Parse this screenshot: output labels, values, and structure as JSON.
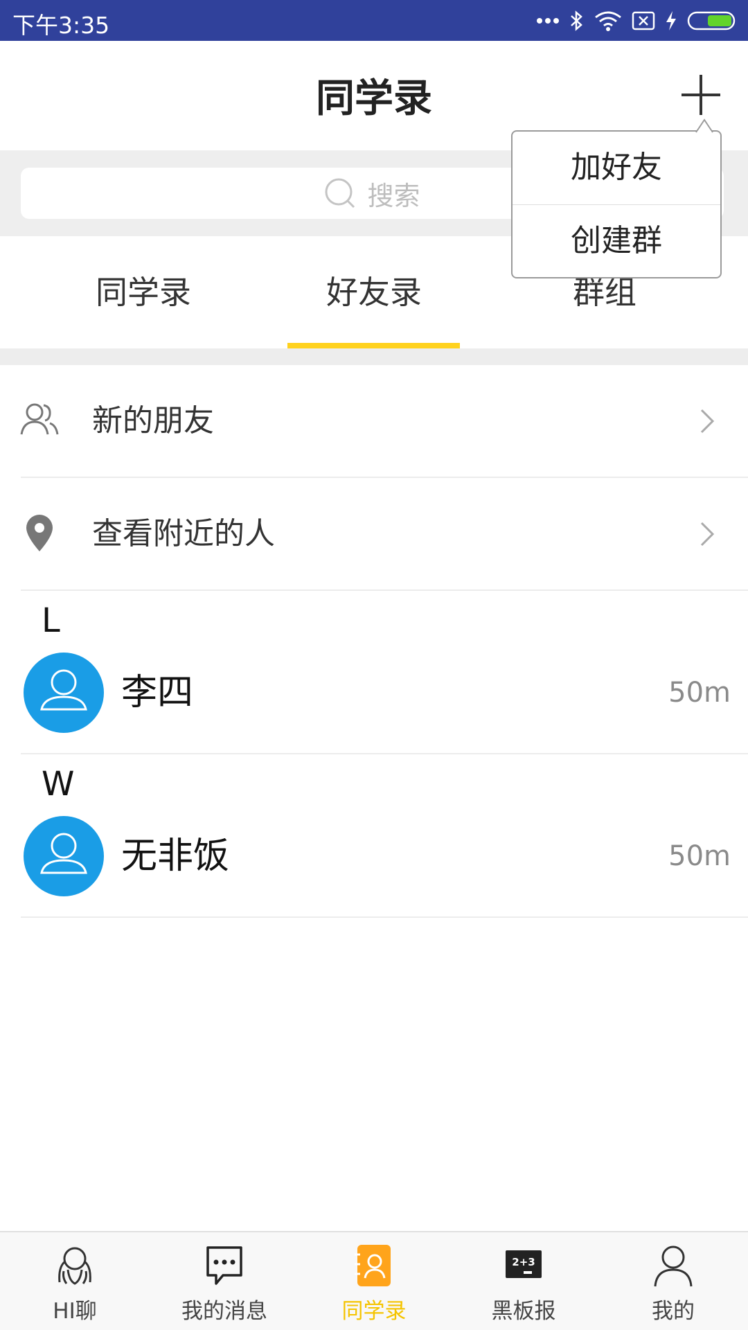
{
  "status_bar": {
    "time": "下午3:35",
    "battery_color": "#62d32b"
  },
  "header": {
    "title": "同学录",
    "add_icon": "plus-icon"
  },
  "search": {
    "placeholder": "搜索"
  },
  "tabs": [
    {
      "label": "同学录",
      "active": false
    },
    {
      "label": "好友录",
      "active": true
    },
    {
      "label": "群组",
      "active": false
    }
  ],
  "menu": [
    {
      "label": "新的朋友",
      "icon": "people-icon"
    },
    {
      "label": "查看附近的人",
      "icon": "location-pin-icon"
    }
  ],
  "contacts": [
    {
      "letter": "L",
      "name": "李四",
      "distance": "50m"
    },
    {
      "letter": "W",
      "name": "无非饭",
      "distance": "50m"
    }
  ],
  "popup_menu": {
    "items": [
      "加好友",
      "创建群"
    ]
  },
  "bottom_nav": [
    {
      "label": "HI聊",
      "icon": "hi-chat-icon",
      "active": false
    },
    {
      "label": "我的消息",
      "icon": "message-bubble-icon",
      "active": false
    },
    {
      "label": "同学录",
      "icon": "contacts-book-icon",
      "active": true
    },
    {
      "label": "黑板报",
      "icon": "blackboard-icon",
      "active": false
    },
    {
      "label": "我的",
      "icon": "profile-icon",
      "active": false
    }
  ],
  "colors": {
    "status_bar": "#30419b",
    "tab_indicator": "#ffd21e",
    "avatar": "#1a9de6",
    "nav_active": "#f5c400",
    "nav_active_icon_bg": "#ffa41b"
  }
}
